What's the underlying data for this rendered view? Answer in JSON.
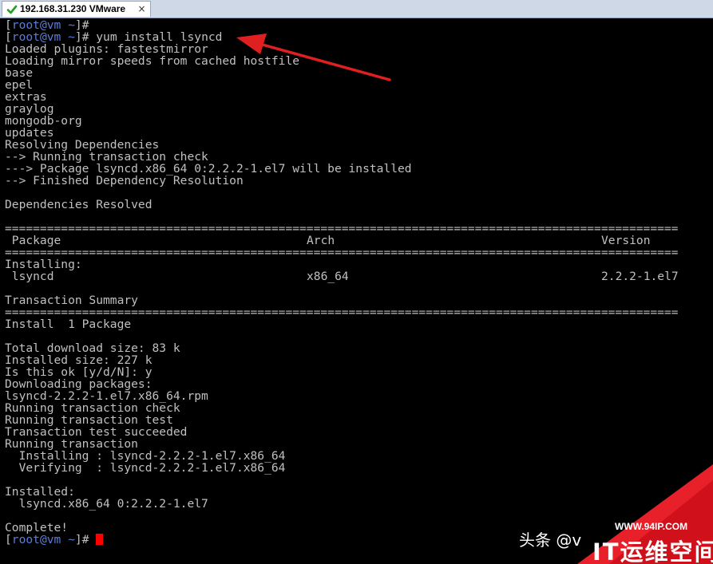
{
  "tab": {
    "title": "192.168.31.230 VMware",
    "close_glyph": "×",
    "icon": "green-checkmark-icon"
  },
  "terminal": {
    "lines": [
      "Loaded plugins: fastestmirror",
      "Loading mirror speeds from cached hostfile",
      "base",
      "epel",
      "extras",
      "graylog",
      "mongodb-org",
      "updates",
      "Resolving Dependencies",
      "--> Running transaction check",
      "---> Package lsyncd.x86_64 0:2.2.2-1.el7 will be installed",
      "--> Finished Dependency Resolution",
      "",
      "Dependencies Resolved",
      "",
      "================================================================================================",
      " Package",
      "================================================================================================",
      "Installing:",
      " lsyncd",
      "",
      "Transaction Summary",
      "================================================================================================",
      "Install  1 Package",
      "",
      "Total download size: 83 k",
      "Installed size: 227 k",
      "Is this ok [y/d/N]: y",
      "Downloading packages:",
      "lsyncd-2.2.2-1.el7.x86_64.rpm",
      "Running transaction check",
      "Running transaction test",
      "Transaction test succeeded",
      "Running transaction",
      "  Installing : lsyncd-2.2.2-1.el7.x86_64",
      "  Verifying  : lsyncd-2.2.2-1.el7.x86_64",
      "",
      "Installed:",
      "  lsyncd.x86_64 0:2.2.2-1.el7",
      "",
      "Complete!"
    ],
    "prompt": {
      "open": "[",
      "user_host": "root@vm",
      "space": " ",
      "dir": "~",
      "close": "]#"
    },
    "command": " yum install lsyncd",
    "table": {
      "header_package": " Package",
      "header_arch": "Arch",
      "header_version": "Version",
      "row_package": " lsyncd",
      "row_arch": "x86_64",
      "row_version": "2.2.2-1.el7"
    }
  },
  "annotation": {
    "arrow_color": "#e02020"
  },
  "watermark": {
    "toutiao": "头条 @v",
    "url": "WWW.94IP.COM",
    "brand": "IT运维空间",
    "color": "#e8202a"
  }
}
